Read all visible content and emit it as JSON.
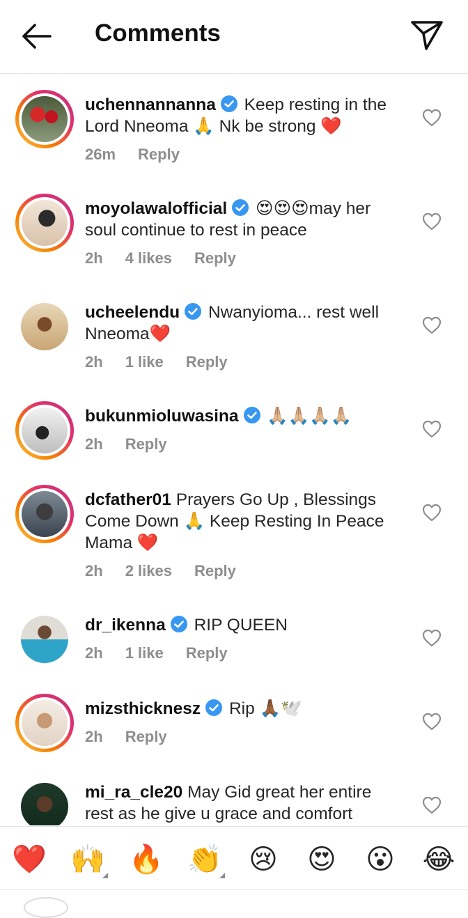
{
  "header": {
    "title": "Comments",
    "back_icon": "arrow-left-icon",
    "share_icon": "paper-plane-icon"
  },
  "comments": [
    {
      "username": "uchennannanna",
      "verified": true,
      "text": "Keep resting in the Lord Nneoma 🙏 Nk be strong ❤️",
      "time": "26m",
      "likes": "",
      "reply_label": "Reply",
      "story_ring": true
    },
    {
      "username": "moyolawalofficial",
      "verified": true,
      "text": "😍😍😍may her soul continue to rest in peace",
      "time": "2h",
      "likes": "4 likes",
      "reply_label": "Reply",
      "story_ring": true
    },
    {
      "username": "ucheelendu",
      "verified": true,
      "text": "Nwanyioma... rest well Nneoma❤️",
      "time": "2h",
      "likes": "1 like",
      "reply_label": "Reply",
      "story_ring": false
    },
    {
      "username": "bukunmioluwasina",
      "verified": true,
      "text": "🙏🏼🙏🏼🙏🏼🙏🏼",
      "time": "2h",
      "likes": "",
      "reply_label": "Reply",
      "story_ring": true
    },
    {
      "username": "dcfather01",
      "verified": false,
      "text": "Prayers Go Up , Blessings Come Down 🙏 Keep Resting In Peace Mama ❤️",
      "time": "2h",
      "likes": "2 likes",
      "reply_label": "Reply",
      "story_ring": true
    },
    {
      "username": "dr_ikenna",
      "verified": true,
      "text": "RIP QUEEN",
      "time": "2h",
      "likes": "1 like",
      "reply_label": "Reply",
      "story_ring": false
    },
    {
      "username": "mizsthicknesz",
      "verified": true,
      "text": "Rip 🙏🏾🕊️",
      "time": "2h",
      "likes": "",
      "reply_label": "Reply",
      "story_ring": true
    },
    {
      "username": "mi_ra_cle20",
      "verified": false,
      "text": "May Gid great her entire rest as he give u grace and comfort",
      "time": "",
      "likes": "",
      "reply_label": "",
      "story_ring": false
    }
  ],
  "emoji_bar": [
    {
      "glyph": "❤️",
      "name": "red-heart",
      "has_variants": false
    },
    {
      "glyph": "🙌",
      "name": "raising-hands",
      "has_variants": true
    },
    {
      "glyph": "🔥",
      "name": "fire",
      "has_variants": false
    },
    {
      "glyph": "👏",
      "name": "clapping-hands",
      "has_variants": true
    },
    {
      "glyph": "😢",
      "name": "crying-face",
      "has_variants": false
    },
    {
      "glyph": "😍",
      "name": "heart-eyes",
      "has_variants": false
    },
    {
      "glyph": "😮",
      "name": "astonished-face",
      "has_variants": false
    },
    {
      "glyph": "😂",
      "name": "tears-of-joy",
      "has_variants": false
    }
  ],
  "colors": {
    "verified_badge": "#3897f0",
    "secondary_text": "#8e8e8e",
    "divider": "#e4e4e4"
  }
}
